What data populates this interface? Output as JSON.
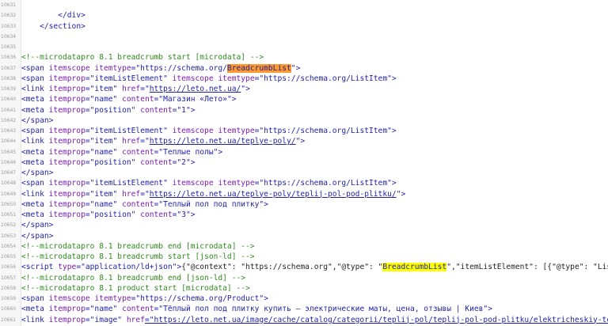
{
  "lines": [
    {
      "number": "10631",
      "segments": []
    },
    {
      "number": "10632",
      "segments": [
        {
          "text": "        ",
          "cls": "p"
        },
        {
          "text": "</div>",
          "cls": "t"
        }
      ]
    },
    {
      "number": "10633",
      "segments": [
        {
          "text": "    ",
          "cls": "p"
        },
        {
          "text": "</section>",
          "cls": "t"
        }
      ]
    },
    {
      "number": "10634",
      "segments": []
    },
    {
      "number": "10635",
      "segments": []
    },
    {
      "number": "10636",
      "segments": [
        {
          "text": "<!--microdatapro 8.1 breadcrumb start [microdata] -->",
          "cls": "c"
        }
      ]
    },
    {
      "number": "10637",
      "segments": [
        {
          "text": "<span ",
          "cls": "t"
        },
        {
          "text": "itemscope itemtype",
          "cls": "a"
        },
        {
          "text": "=\"https://schema.org/",
          "cls": "v"
        },
        {
          "text": "BreadcrumbList",
          "cls": "hl-orange"
        },
        {
          "text": "\">",
          "cls": "v"
        }
      ]
    },
    {
      "number": "10638",
      "segments": [
        {
          "text": "<span ",
          "cls": "t"
        },
        {
          "text": "itemprop",
          "cls": "a"
        },
        {
          "text": "=\"itemListElement\" ",
          "cls": "v"
        },
        {
          "text": "itemscope itemtype",
          "cls": "a"
        },
        {
          "text": "=\"https://schema.org/ListItem\">",
          "cls": "v"
        }
      ]
    },
    {
      "number": "10639",
      "segments": [
        {
          "text": "<link ",
          "cls": "t"
        },
        {
          "text": "itemprop",
          "cls": "a"
        },
        {
          "text": "=\"item\" ",
          "cls": "v"
        },
        {
          "text": "href",
          "cls": "a"
        },
        {
          "text": "=\"",
          "cls": "v"
        },
        {
          "text": "https://leto.net.ua/",
          "cls": "v u"
        },
        {
          "text": "\">",
          "cls": "v"
        }
      ]
    },
    {
      "number": "10640",
      "segments": [
        {
          "text": "<meta ",
          "cls": "t"
        },
        {
          "text": "itemprop",
          "cls": "a"
        },
        {
          "text": "=\"name\" ",
          "cls": "v"
        },
        {
          "text": "content",
          "cls": "a"
        },
        {
          "text": "=\"Магазин «Лето»\">",
          "cls": "v"
        }
      ]
    },
    {
      "number": "10641",
      "segments": [
        {
          "text": "<meta ",
          "cls": "t"
        },
        {
          "text": "itemprop",
          "cls": "a"
        },
        {
          "text": "=\"position\" ",
          "cls": "v"
        },
        {
          "text": "content",
          "cls": "a"
        },
        {
          "text": "=\"1\">",
          "cls": "v"
        }
      ]
    },
    {
      "number": "10642",
      "segments": [
        {
          "text": "</span>",
          "cls": "t"
        }
      ]
    },
    {
      "number": "10643",
      "segments": [
        {
          "text": "<span ",
          "cls": "t"
        },
        {
          "text": "itemprop",
          "cls": "a"
        },
        {
          "text": "=\"itemListElement\" ",
          "cls": "v"
        },
        {
          "text": "itemscope itemtype",
          "cls": "a"
        },
        {
          "text": "=\"https://schema.org/ListItem\">",
          "cls": "v"
        }
      ]
    },
    {
      "number": "10644",
      "segments": [
        {
          "text": "<link ",
          "cls": "t"
        },
        {
          "text": "itemprop",
          "cls": "a"
        },
        {
          "text": "=\"item\" ",
          "cls": "v"
        },
        {
          "text": "href",
          "cls": "a"
        },
        {
          "text": "=\"",
          "cls": "v"
        },
        {
          "text": "https://leto.net.ua/teplye-poly/",
          "cls": "v u"
        },
        {
          "text": "\">",
          "cls": "v"
        }
      ]
    },
    {
      "number": "10645",
      "segments": [
        {
          "text": "<meta ",
          "cls": "t"
        },
        {
          "text": "itemprop",
          "cls": "a"
        },
        {
          "text": "=\"name\" ",
          "cls": "v"
        },
        {
          "text": "content",
          "cls": "a"
        },
        {
          "text": "=\"Теплые полы\">",
          "cls": "v"
        }
      ]
    },
    {
      "number": "10646",
      "segments": [
        {
          "text": "<meta ",
          "cls": "t"
        },
        {
          "text": "itemprop",
          "cls": "a"
        },
        {
          "text": "=\"position\" ",
          "cls": "v"
        },
        {
          "text": "content",
          "cls": "a"
        },
        {
          "text": "=\"2\">",
          "cls": "v"
        }
      ]
    },
    {
      "number": "10647",
      "segments": [
        {
          "text": "</span>",
          "cls": "t"
        }
      ]
    },
    {
      "number": "10648",
      "segments": [
        {
          "text": "<span ",
          "cls": "t"
        },
        {
          "text": "itemprop",
          "cls": "a"
        },
        {
          "text": "=\"itemListElement\" ",
          "cls": "v"
        },
        {
          "text": "itemscope itemtype",
          "cls": "a"
        },
        {
          "text": "=\"https://schema.org/ListItem\">",
          "cls": "v"
        }
      ]
    },
    {
      "number": "10649",
      "segments": [
        {
          "text": "<link ",
          "cls": "t"
        },
        {
          "text": "itemprop",
          "cls": "a"
        },
        {
          "text": "=\"item\" ",
          "cls": "v"
        },
        {
          "text": "href",
          "cls": "a"
        },
        {
          "text": "=\"",
          "cls": "v"
        },
        {
          "text": "https://leto.net.ua/teplye-poly/teplij-pol-pod-plitku/",
          "cls": "v u"
        },
        {
          "text": "\">",
          "cls": "v"
        }
      ]
    },
    {
      "number": "10650",
      "segments": [
        {
          "text": "<meta ",
          "cls": "t"
        },
        {
          "text": "itemprop",
          "cls": "a"
        },
        {
          "text": "=\"name\" ",
          "cls": "v"
        },
        {
          "text": "content",
          "cls": "a"
        },
        {
          "text": "=\"Теплый пол под плитку\">",
          "cls": "v"
        }
      ]
    },
    {
      "number": "10651",
      "segments": [
        {
          "text": "<meta ",
          "cls": "t"
        },
        {
          "text": "itemprop",
          "cls": "a"
        },
        {
          "text": "=\"position\" ",
          "cls": "v"
        },
        {
          "text": "content",
          "cls": "a"
        },
        {
          "text": "=\"3\">",
          "cls": "v"
        }
      ]
    },
    {
      "number": "10652",
      "segments": [
        {
          "text": "</span>",
          "cls": "t"
        }
      ]
    },
    {
      "number": "10653",
      "segments": [
        {
          "text": "</span>",
          "cls": "t"
        }
      ]
    },
    {
      "number": "10654",
      "segments": [
        {
          "text": "<!--microdatapro 8.1 breadcrumb end [microdata] -->",
          "cls": "c"
        }
      ]
    },
    {
      "number": "10655",
      "segments": [
        {
          "text": "<!--microdatapro 8.1 breadcrumb start [json-ld] -->",
          "cls": "c"
        }
      ]
    },
    {
      "number": "10656",
      "segments": [
        {
          "text": "<script ",
          "cls": "t"
        },
        {
          "text": "type",
          "cls": "a"
        },
        {
          "text": "=\"application/ld+json\">",
          "cls": "v"
        },
        {
          "text": "{\"@context\": \"https://schema.org\",\"@type\": \"",
          "cls": "p"
        },
        {
          "text": "BreadcrumbList",
          "cls": "hl-yellow"
        },
        {
          "text": "\",\"itemListElement\": [{\"@type\": \"List",
          "cls": "p"
        }
      ]
    },
    {
      "number": "10657",
      "segments": [
        {
          "text": "<!--microdatapro 8.1 breadcrumb end [json-ld] -->",
          "cls": "c"
        }
      ]
    },
    {
      "number": "10658",
      "segments": [
        {
          "text": "<!--microdatapro 8.1 product start [microdata] -->",
          "cls": "c"
        }
      ]
    },
    {
      "number": "10659",
      "segments": [
        {
          "text": "<span ",
          "cls": "t"
        },
        {
          "text": "itemscope itemtype",
          "cls": "a"
        },
        {
          "text": "=\"https://schema.org/Product\">",
          "cls": "v"
        }
      ]
    },
    {
      "number": "10660",
      "segments": [
        {
          "text": "<meta ",
          "cls": "t"
        },
        {
          "text": "itemprop",
          "cls": "a"
        },
        {
          "text": "=\"name\" ",
          "cls": "v"
        },
        {
          "text": "content",
          "cls": "a"
        },
        {
          "text": "=\"Тёплый пол под плитку купить – электрические маты, цена, отзывы | Киев\">",
          "cls": "v"
        }
      ]
    },
    {
      "number": "10661",
      "segments": [
        {
          "text": "<link ",
          "cls": "t"
        },
        {
          "text": "itemprop",
          "cls": "a"
        },
        {
          "text": "=\"image\" ",
          "cls": "v"
        },
        {
          "text": "href",
          "cls": "a"
        },
        {
          "text": "=\"https://leto.net.ua/image/cache/catalog/categorii/teplij-pol/teplij-pol-pod-plitku/elektricheskiy-te",
          "cls": "v u"
        }
      ]
    }
  ]
}
